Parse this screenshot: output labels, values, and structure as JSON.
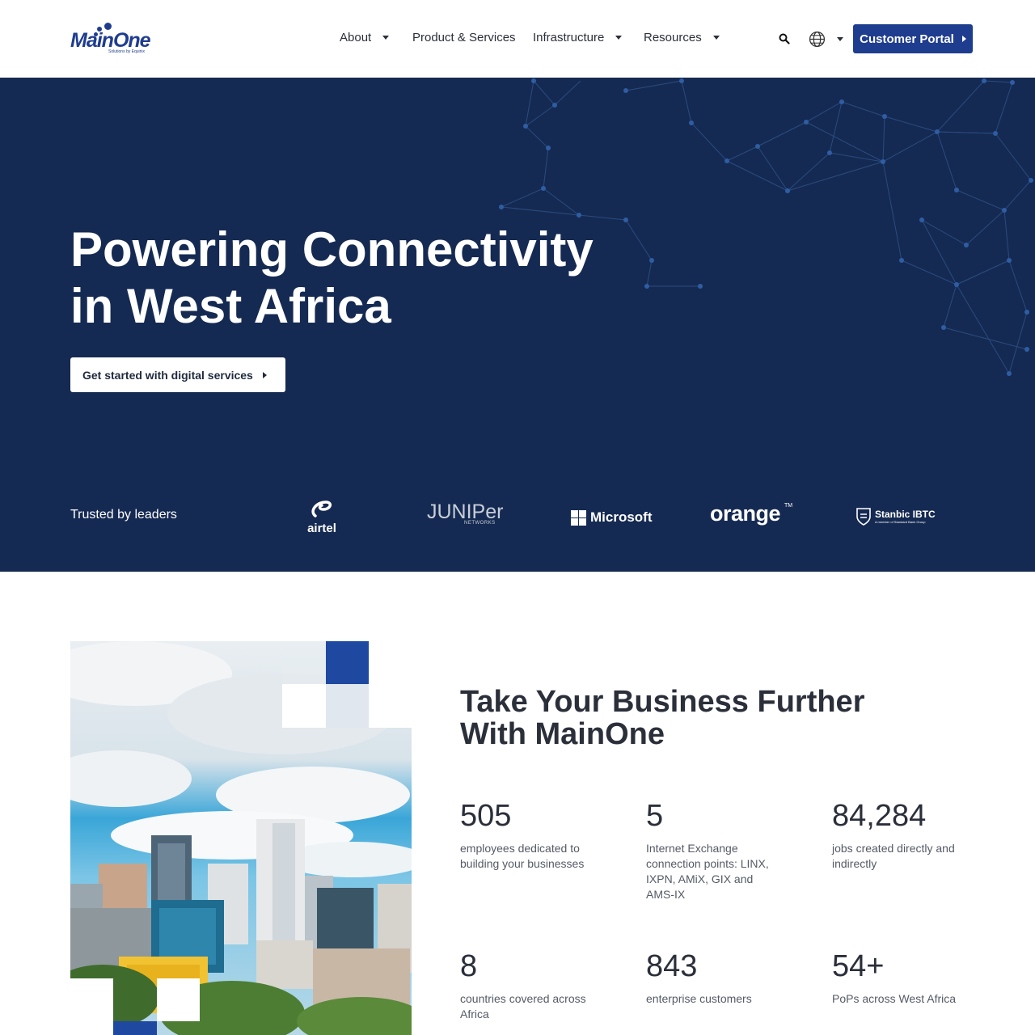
{
  "header": {
    "logo_text": "MainOne",
    "logo_tagline": "Solutions by Equinix",
    "nav": [
      {
        "label": "About",
        "has_dropdown": true
      },
      {
        "label": "Product & Services",
        "has_dropdown": false
      },
      {
        "label": "Infrastructure",
        "has_dropdown": true
      },
      {
        "label": "Resources",
        "has_dropdown": true
      }
    ],
    "search_icon": "search-icon",
    "language_icon": "globe-icon",
    "portal_label": "Customer Portal"
  },
  "hero": {
    "title_line1": "Powering Connectivity",
    "title_line2": "in West Africa",
    "cta_label": "Get started with digital services",
    "trusted_label": "Trusted by leaders",
    "brands": [
      "airtel",
      "JUNIPer",
      "NETWORKS",
      "Microsoft",
      "orange",
      "TM",
      "Stanbic IBTC",
      "A member of Standard Bank Group"
    ]
  },
  "stats": {
    "title_line1": "Take Your Business Further",
    "title_line2": "With MainOne",
    "items": [
      {
        "value": "505",
        "label": "employees dedicated to building your businesses"
      },
      {
        "value": "5",
        "label": "Internet Exchange connection points: LINX, IXPN, AMiX, GIX and AMS-IX"
      },
      {
        "value": "84,284",
        "label": "jobs created directly and indirectly"
      },
      {
        "value": "8",
        "label": "countries covered across Africa"
      },
      {
        "value": "843",
        "label": "enterprise customers"
      },
      {
        "value": "54+",
        "label": "PoPs across West Africa"
      }
    ]
  },
  "colors": {
    "brand_blue": "#1f3d8f",
    "hero_bg": "#152a52",
    "text_dark": "#2b2f3a"
  }
}
